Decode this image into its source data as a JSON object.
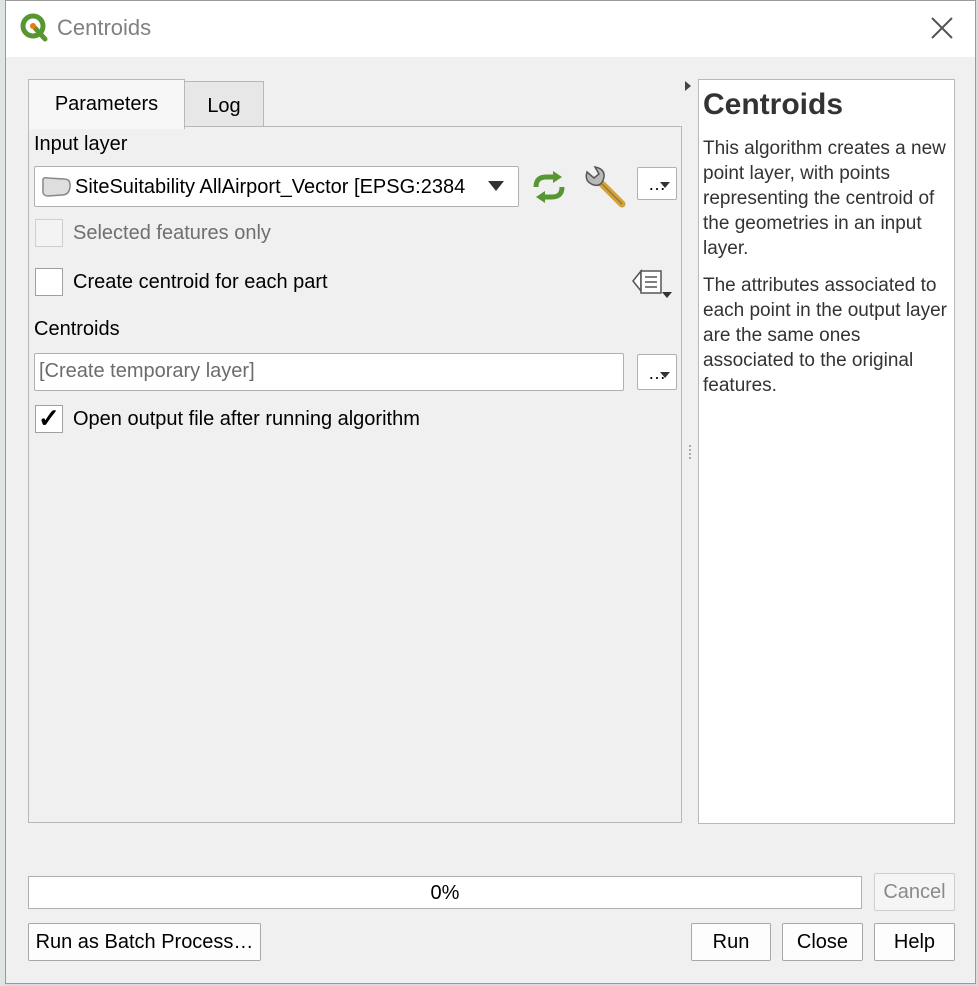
{
  "window": {
    "title": "Centroids"
  },
  "tabs": [
    {
      "label": "Parameters",
      "active": true
    },
    {
      "label": "Log",
      "active": false
    }
  ],
  "params": {
    "input_layer_label": "Input layer",
    "input_layer_value": "SiteSuitability AllAirport_Vector [EPSG:2384",
    "selected_only_label": "Selected features only",
    "selected_only_checked": false,
    "selected_only_enabled": false,
    "each_part_label": "Create centroid for each part",
    "each_part_checked": false,
    "centroids_label": "Centroids",
    "centroids_placeholder": "[Create temporary layer]",
    "open_output_label": "Open output file after running algorithm",
    "open_output_checked": true,
    "browse_label": "…"
  },
  "help": {
    "title": "Centroids",
    "paragraphs": [
      "This algorithm creates a new point layer, with points representing the centroid of the geometries in an input layer.",
      "The attributes associated to each point in the output layer are the same ones associated to the original features."
    ]
  },
  "progress": {
    "value": 0,
    "text": "0%"
  },
  "buttons": {
    "cancel": "Cancel",
    "batch": "Run as Batch Process…",
    "run": "Run",
    "close": "Close",
    "help": "Help"
  },
  "icons": {
    "app": "qgis-logo-icon",
    "close": "close-icon",
    "iterate": "iterate-icon",
    "settings": "wrench-icon",
    "field_options": "field-options-icon"
  },
  "colors": {
    "accent_green": "#589632",
    "logo_yellow": "#ee7913",
    "progress_fill": "#06b025"
  }
}
